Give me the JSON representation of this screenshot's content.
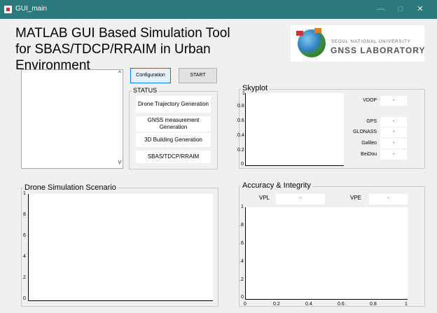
{
  "window": {
    "title": "GUI_main",
    "minimize": "—",
    "maximize": "□",
    "close": "✕"
  },
  "header": {
    "line1": "MATLAB GUI Based Simulation Tool",
    "line2": "for SBAS/TDCP/RRAIM in Urban Environment"
  },
  "logo": {
    "university": "SEOUL NATIONAL UNIVERSITY",
    "lab": "GNSS LABORATORY"
  },
  "list": {
    "up": "^",
    "down": "v"
  },
  "buttons": {
    "configuration": "Configuration",
    "start": "START"
  },
  "status": {
    "label": "STATUS",
    "items": [
      "Drone Trajectory Generation",
      "GNSS measurement Generation",
      "3D Building Generation",
      "SBAS/TDCP/RRAIM"
    ]
  },
  "skyplot": {
    "label": "Skyplot",
    "yticks": [
      "1",
      "0.8",
      "0.6",
      "0.4",
      "0.2",
      "0"
    ],
    "vdop_label": "VDOP",
    "vdop_value": "-",
    "constellations": [
      {
        "name": "GPS",
        "value": "-"
      },
      {
        "name": "GLONASS",
        "value": "-"
      },
      {
        "name": "Galileo",
        "value": "-"
      },
      {
        "name": "BeiDou",
        "value": "-"
      }
    ]
  },
  "drone": {
    "label": "Drone Simulation Scenario",
    "yticks": [
      "1",
      "8",
      "6",
      "4",
      "2",
      "0"
    ]
  },
  "accuracy": {
    "label": "Accuracy & Integrity",
    "vpl_label": "VPL",
    "vpl_value": "-",
    "vpe_label": "VPE",
    "vpe_value": "-",
    "yticks": [
      "1",
      ".8",
      ".6",
      ".4",
      ".2",
      "0"
    ],
    "xticks": [
      "0",
      "0.2",
      "0.4",
      "0.6",
      "0.8",
      "1"
    ]
  },
  "colors": {
    "titlebar": "#2a7a7e",
    "accent": "#0078d7"
  }
}
